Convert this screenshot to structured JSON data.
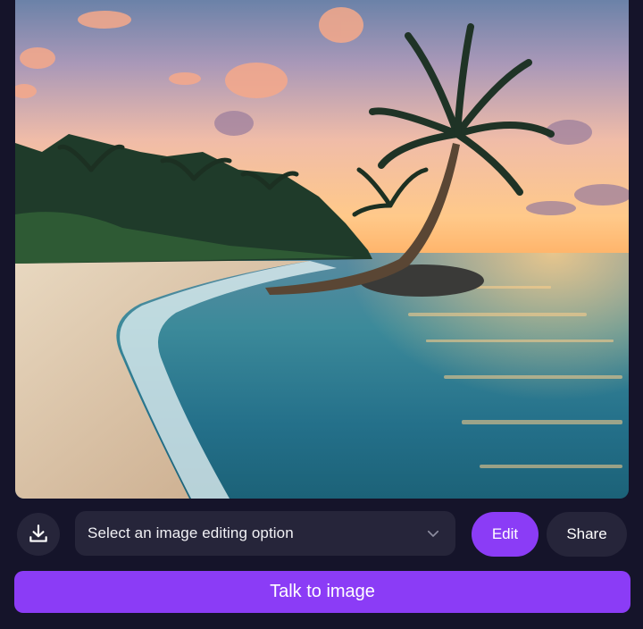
{
  "image": {
    "alt_subject": "beach-sunset-palm-image"
  },
  "toolbar": {
    "download_icon": "download-icon",
    "select_placeholder": "Select an image editing option",
    "select_chevron_icon": "chevron-down-icon",
    "edit_label": "Edit",
    "share_label": "Share"
  },
  "talk_button": {
    "label": "Talk to image"
  },
  "colors": {
    "background": "#15142a",
    "accent": "#8b3cf6",
    "control_bg": "#26253a",
    "text": "#ffffff"
  }
}
